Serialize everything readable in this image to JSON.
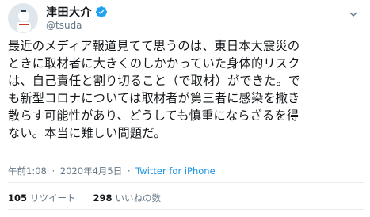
{
  "user": {
    "display_name": "津田大介",
    "handle": "@tsuda",
    "verified": true
  },
  "tweet": {
    "text": "最近のメディア報道見てて思うのは、東日本大震災の\nときに取材者に大きくのしかかっていた身体的リスク\nは、自己責任と割り切ること（で取材）ができた。で\nも新型コロナについては取材者が第三者に感染を撒き\n散らす可能性があり、どうしても慎重にならざるを得\nない。本当に難しい問題だ。"
  },
  "meta": {
    "time": "午前1:08",
    "separator": "·",
    "date": "2020年4月5日",
    "source": "Twitter for iPhone"
  },
  "stats": {
    "retweets_count": "105",
    "retweets_label": "リツイート",
    "likes_count": "298",
    "likes_label": "いいねの数"
  },
  "colors": {
    "link": "#1b95e0",
    "secondary_text": "#657786",
    "verified_badge": "#1da1f2"
  },
  "icons": {
    "verified": "verified-badge-icon",
    "menu": "chevron-down-icon"
  }
}
